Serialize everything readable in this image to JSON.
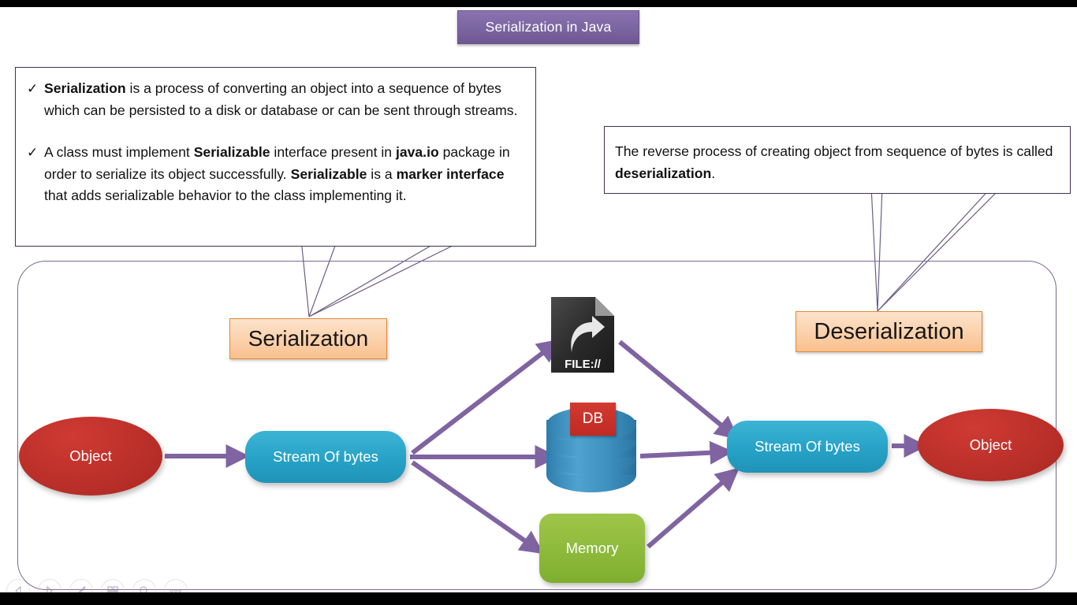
{
  "slide": {
    "title": "Serialization in Java",
    "left_note": {
      "bullets": [
        {
          "marker": "✓",
          "runs": [
            {
              "t": "Serialization",
              "b": true
            },
            {
              "t": " is a process of converting an object into a sequence of bytes which can be persisted to a disk or database or can be sent through streams.",
              "b": false
            }
          ]
        },
        {
          "marker": "✓",
          "runs": [
            {
              "t": "A class must implement ",
              "b": false
            },
            {
              "t": "Serializable",
              "b": true
            },
            {
              "t": " interface present in ",
              "b": false
            },
            {
              "t": "java.io",
              "b": true
            },
            {
              "t": " package in order to serialize its object successfully. ",
              "b": false
            },
            {
              "t": "Serializable",
              "b": true
            },
            {
              "t": " is a ",
              "b": false
            },
            {
              "t": "marker interface",
              "b": true
            },
            {
              "t": " that adds serializable behavior to the class implementing it.",
              "b": false
            }
          ]
        }
      ]
    },
    "right_note": {
      "runs": [
        {
          "t": "The reverse process of creating object from sequence of bytes is called ",
          "b": false
        },
        {
          "t": "deserialization",
          "b": true
        },
        {
          "t": ".",
          "b": false
        }
      ]
    },
    "labels": {
      "serialization": "Serialization",
      "deserialization": "Deserialization"
    },
    "nodes": {
      "object_left": "Object",
      "stream_left": "Stream Of bytes",
      "file": "FILE://",
      "db": "DB",
      "memory": "Memory",
      "stream_right": "Stream Of bytes",
      "object_right": "Object"
    },
    "colors": {
      "title_plate": "#7e68a4",
      "arrow": "#8064a2",
      "label_box": "#fbd2ad",
      "object": "#c0322c",
      "stream": "#27a2c6",
      "memory": "#8fbb3c",
      "db": "#3d8fbe",
      "db_badge": "#c02a22",
      "frame_border": "#7c6a95"
    }
  },
  "toolbar": {
    "items": [
      {
        "name": "previous-slide",
        "icon": "triangle-left-icon"
      },
      {
        "name": "next-slide",
        "icon": "triangle-right-icon"
      },
      {
        "name": "pen",
        "icon": "pen-icon"
      },
      {
        "name": "slide-grid",
        "icon": "grid-icon"
      },
      {
        "name": "zoom",
        "icon": "magnifier-icon"
      },
      {
        "name": "more-options",
        "icon": "ellipsis-icon"
      }
    ]
  }
}
